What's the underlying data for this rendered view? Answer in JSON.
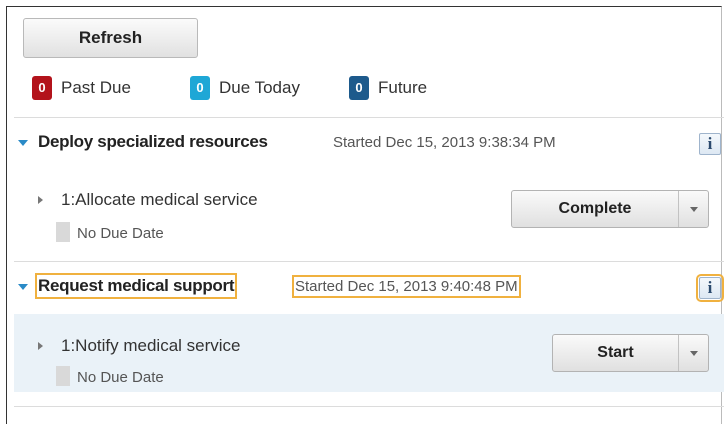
{
  "toolbar": {
    "refresh_label": "Refresh"
  },
  "counts": [
    {
      "value": "0",
      "label": "Past Due",
      "color": "#b3131b"
    },
    {
      "value": "0",
      "label": "Due Today",
      "color": "#1ea7d6"
    },
    {
      "value": "0",
      "label": "Future",
      "color": "#1d5a8c"
    }
  ],
  "groups": [
    {
      "title": "Deploy specialized resources",
      "started": "Started Dec 15, 2013 9:38:34 PM",
      "info_label": "i",
      "tasks": [
        {
          "name": "1:Allocate medical service",
          "due": "No Due Date",
          "action": "Complete"
        }
      ]
    },
    {
      "title": "Request medical support",
      "started": "Started Dec 15, 2013 9:40:48 PM",
      "info_label": "i",
      "tasks": [
        {
          "name": "1:Notify medical service",
          "due": "No Due Date",
          "action": "Start"
        }
      ]
    }
  ],
  "colors": {
    "accent": "#2a8ac7",
    "focus": "#f0b13f",
    "selected_row": "#eaf2f8"
  }
}
